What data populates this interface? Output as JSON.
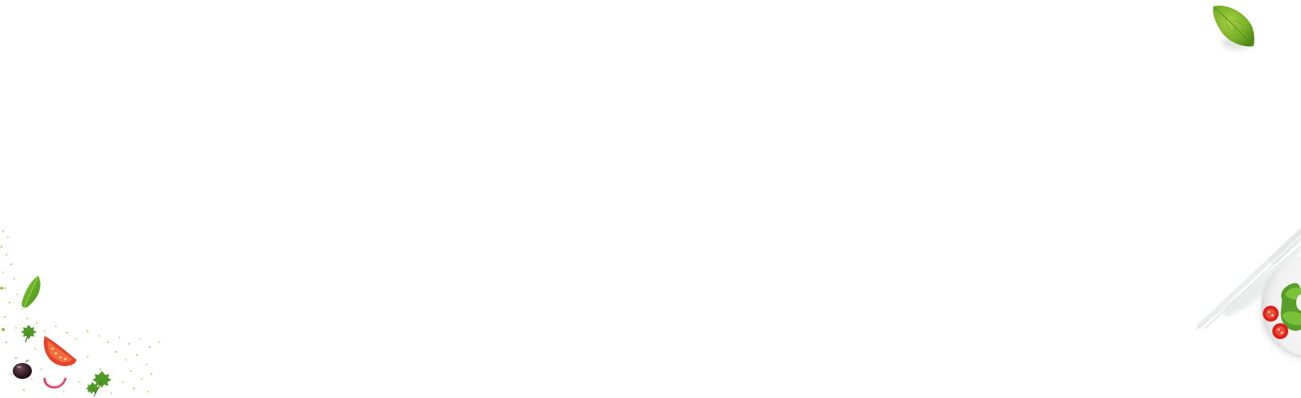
{
  "scene": {
    "background_color": "#ffffff",
    "decorations": [
      {
        "name": "basil-leaf-icon",
        "color": "#7cb32a"
      },
      {
        "name": "basil-leaf-icon",
        "color": "#5aa51e"
      },
      {
        "name": "parsley-icon",
        "color": "#4e9a26"
      },
      {
        "name": "tomato-slice-icon",
        "color": "#e8452a"
      },
      {
        "name": "olive-icon",
        "color": "#3a1f2a"
      },
      {
        "name": "onion-ring-icon",
        "color": "#d24466"
      },
      {
        "name": "herb-crumbs-icon",
        "color": "#b8cf6a"
      },
      {
        "name": "brush-stroke-icon",
        "color": "#dfe5e1"
      },
      {
        "name": "salad-plate-icon",
        "color": "#f3f3f3"
      }
    ]
  }
}
